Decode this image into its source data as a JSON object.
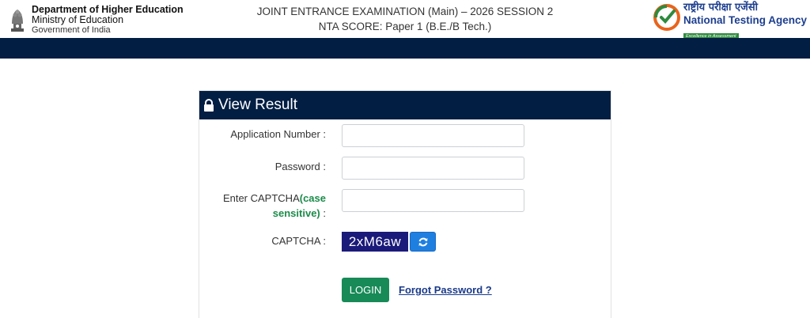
{
  "header": {
    "ministry_line1": "Department of Higher Education",
    "ministry_line2": "Ministry of Education",
    "ministry_line3": "Government of India",
    "title_line1": "JOINT ENTRANCE EXAMINATION (Main) – 2026 SESSION 2",
    "title_line2": "NTA SCORE: Paper 1 (B.E./B Tech.)",
    "nta_hindi": "राष्ट्रीय परीक्षा एजेंसी",
    "nta_english": "National Testing Agency",
    "nta_tagline": "Excellence in Assessment"
  },
  "card": {
    "title": "View Result",
    "title_icon": "lock-icon"
  },
  "form": {
    "application_label": "Application Number :",
    "application_value": "",
    "password_label": "Password :",
    "password_value": "",
    "captcha_label_prefix": "Enter CAPTCHA",
    "captcha_label_note": "(case sensitive)",
    "captcha_label_suffix": " :",
    "captcha_value": "",
    "captcha_display_label": "CAPTCHA :",
    "captcha_text": "2xM6aw",
    "refresh_icon": "refresh-icon",
    "login_label": "LOGIN",
    "forgot_label": "Forgot Password ?"
  },
  "colors": {
    "navy": "#021e43",
    "green_accent": "#1b8c4a",
    "login_green": "#178a57",
    "refresh_blue": "#1e7fe0",
    "captcha_bg": "#1a1a7a"
  }
}
